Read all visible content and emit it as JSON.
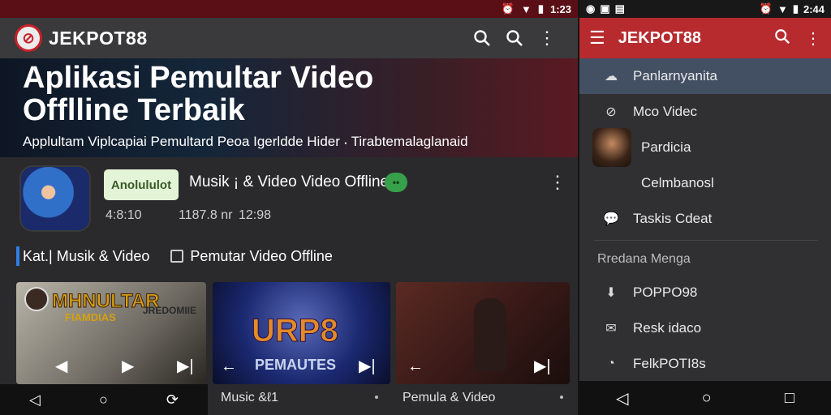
{
  "left": {
    "status": {
      "time": "1:23"
    },
    "appbar": {
      "brand": "JEKPOT88",
      "logo_icon": "no-symbol-icon"
    },
    "hero": {
      "title_line1": "Aplikasi Pemultar Video",
      "title_line2": "Offlline  Terbaik",
      "subtitle": "Applultam Viplcapiai Pemultard Peoa Igerldde Hider ⸳ Tirabtemalaglanaid"
    },
    "app": {
      "install_label": "Anolululot",
      "name": "Musik ¡  & Video Video Offline",
      "badge": "••",
      "meta": [
        "4:8:10",
        "1187.8 nr",
        "12:98"
      ]
    },
    "chips": [
      "Kat.| Musik & Video",
      "Pemutar Video Offline"
    ],
    "cards": [
      {
        "title": "MHNULTAR",
        "subtitle": "FIAMDIAS",
        "tag": "JREDOMIIE",
        "caption": "Music &ℓ1"
      },
      {
        "title": "URP8",
        "subtitle": "PEMAUTES",
        "caption": ""
      },
      {
        "title": "",
        "caption": "Pemula & Video"
      }
    ]
  },
  "right": {
    "status": {
      "time": "2:44"
    },
    "appbar": {
      "brand": "JEKPOT88"
    },
    "menu": [
      {
        "label": "Panlarnyanita",
        "icon": "cloud-icon",
        "active": true
      },
      {
        "label": "Mco Videc",
        "icon": "compass-icon"
      },
      {
        "label": "Pardicia",
        "icon": "thumbnail"
      },
      {
        "label": "Celmbanosl",
        "icon": ""
      },
      {
        "label": "Taskis Cdeat",
        "icon": "chat-icon"
      }
    ],
    "section": "Rredana Menga",
    "menu2": [
      {
        "label": "POPPO98",
        "icon": "download-icon"
      },
      {
        "label": "Resk idaco",
        "icon": "mail-icon"
      },
      {
        "label": "FelkPOTI8s",
        "icon": "chat-bubble-icon"
      }
    ]
  }
}
